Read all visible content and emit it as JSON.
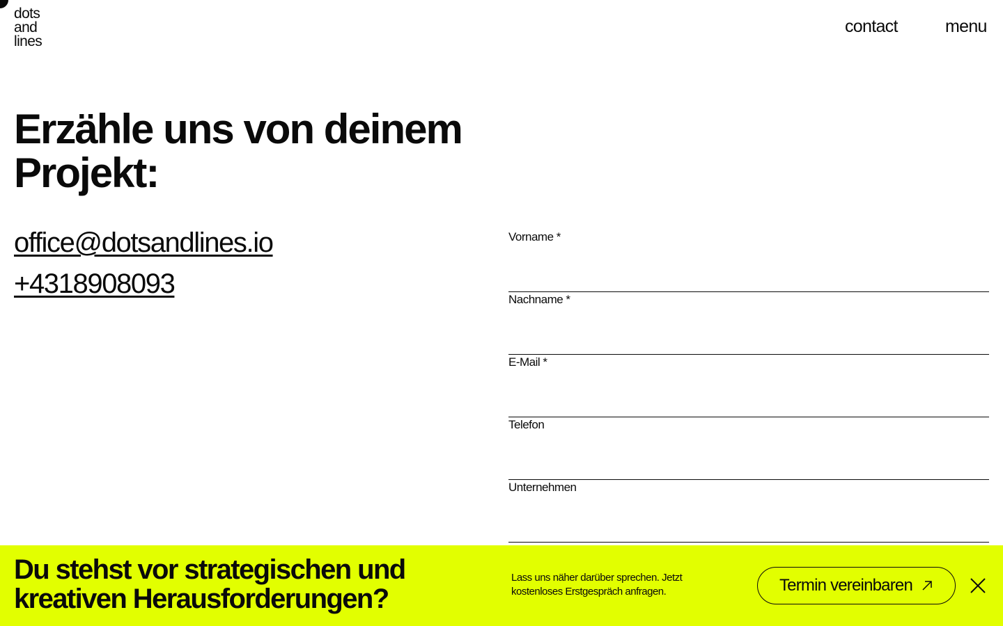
{
  "header": {
    "logo_lines": [
      "dots",
      "and",
      "lines"
    ],
    "nav": {
      "contact": "contact",
      "menu": "menu"
    }
  },
  "hero": {
    "headline": "Erzähle uns von deinem Projekt:"
  },
  "contact": {
    "email": "office@dotsandlines.io",
    "phone": "+4318908093"
  },
  "form": {
    "fields": [
      {
        "label": "Vorname *",
        "value": ""
      },
      {
        "label": "Nachname *",
        "value": ""
      },
      {
        "label": "E-Mail *",
        "value": ""
      },
      {
        "label": "Telefon",
        "value": ""
      },
      {
        "label": "Unternehmen",
        "value": ""
      }
    ]
  },
  "banner": {
    "title": "Du stehst vor strategischen und kreativen Herausforderungen?",
    "text": "Lass uns näher darüber sprechen. Jetzt kostenloses Erstgespräch anfragen.",
    "button_label": "Termin vereinbaren",
    "button_icon": "arrow-up-right-icon",
    "close_icon": "close-icon",
    "background": "#e2ff00"
  }
}
